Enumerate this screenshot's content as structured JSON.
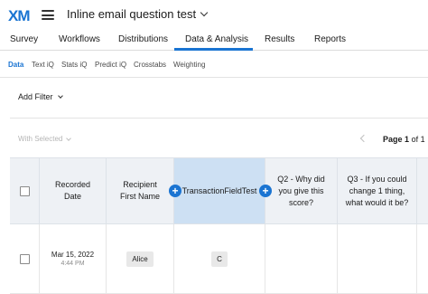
{
  "app": {
    "logo": "XM",
    "project_title": "Inline email question test"
  },
  "nav": {
    "tabs": [
      {
        "label": "Survey"
      },
      {
        "label": "Workflows"
      },
      {
        "label": "Distributions"
      },
      {
        "label": "Data & Analysis"
      },
      {
        "label": "Results"
      },
      {
        "label": "Reports"
      }
    ],
    "active": "Data & Analysis"
  },
  "subnav": {
    "items": [
      {
        "label": "Data"
      },
      {
        "label": "Text iQ"
      },
      {
        "label": "Stats iQ"
      },
      {
        "label": "Predict iQ"
      },
      {
        "label": "Crosstabs"
      },
      {
        "label": "Weighting"
      }
    ],
    "active": "Data"
  },
  "filter": {
    "label": "Add Filter"
  },
  "toolbar": {
    "with_selected": "With Selected",
    "page_label": "Page",
    "page_current": "1",
    "page_of": "of",
    "page_total": "1"
  },
  "table": {
    "columns": [
      {
        "label": "Recorded Date"
      },
      {
        "label": "Recipient First Name"
      },
      {
        "label": "TransactionFieldTest"
      },
      {
        "label": "Q2 - Why did you give this score?"
      },
      {
        "label": "Q3 - If you could change 1 thing, what would it be?"
      }
    ],
    "rows": [
      {
        "recorded_date": "Mar 15, 2022",
        "recorded_time": "4:44 PM",
        "first_name": "Alice",
        "transaction_field": "C",
        "q2": "",
        "q3": ""
      }
    ]
  },
  "colors": {
    "accent": "#1a74d2",
    "header_bg": "#eef1f5",
    "highlight_col": "#cde0f3"
  }
}
